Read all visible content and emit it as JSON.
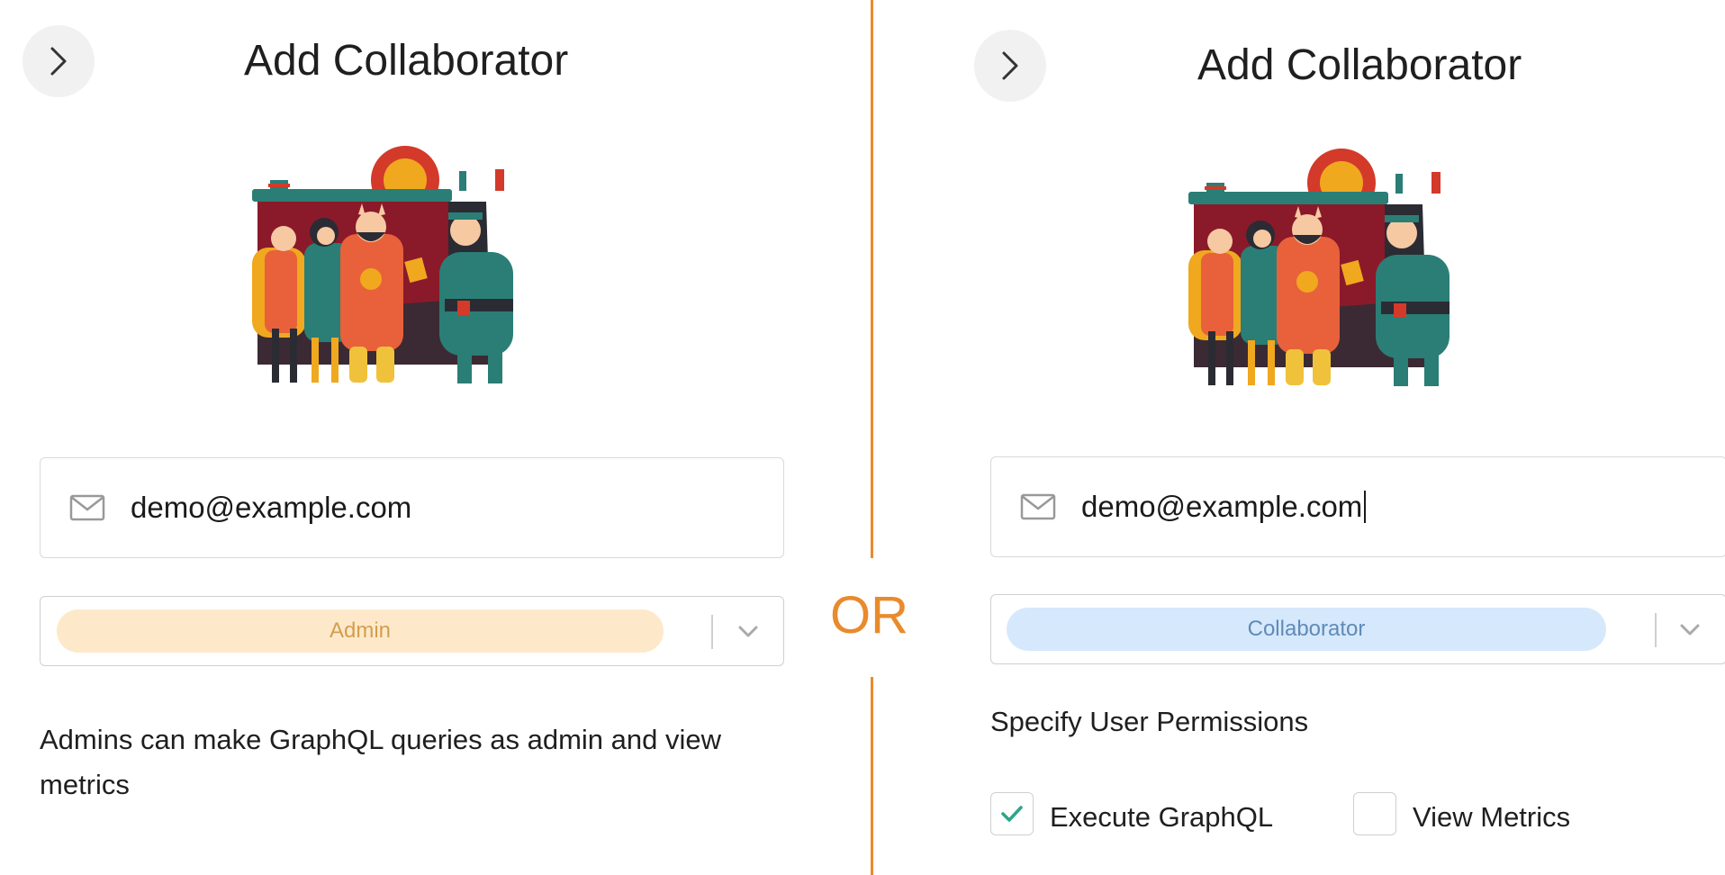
{
  "left": {
    "title": "Add Collaborator",
    "email": {
      "value": "demo@example.com",
      "icon": "mail-icon"
    },
    "role": {
      "selected": "Admin",
      "color": "#fde9ca",
      "text_color": "#d39e4e"
    },
    "description": "Admins can make GraphQL queries as admin and view metrics"
  },
  "separator": {
    "label": "OR",
    "color": "#e98a2c"
  },
  "right": {
    "title": "Add Collaborator",
    "email": {
      "value": "demo@example.com",
      "icon": "mail-icon"
    },
    "role": {
      "selected": "Collaborator",
      "color": "#d6e8fc",
      "text_color": "#5f8bb7"
    },
    "permissions": {
      "title": "Specify User Permissions",
      "items": [
        {
          "label": "Execute GraphQL",
          "checked": true
        },
        {
          "label": "View Metrics",
          "checked": false
        }
      ]
    }
  }
}
